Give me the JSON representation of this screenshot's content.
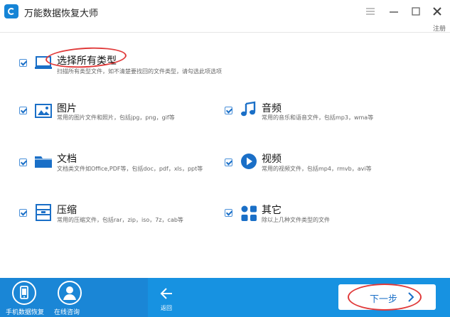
{
  "window": {
    "title": "万能数据恢复大师",
    "register_label": "注册"
  },
  "options": {
    "all": {
      "title": "选择所有类型",
      "desc": "扫描所有类型文件，如不清楚要找回的文件类型，请勾选此项选项",
      "checked": true,
      "icon": "monitor-icon"
    },
    "images": {
      "title": "图片",
      "desc": "常用的图片文件和照片，包括jpg，png，gif等",
      "checked": true,
      "icon": "image-icon"
    },
    "audio": {
      "title": "音频",
      "desc": "常用的音乐和语音文件，包括mp3，wma等",
      "checked": true,
      "icon": "music-note-icon"
    },
    "documents": {
      "title": "文档",
      "desc": "文档类文件如Office,PDF等，包括doc，pdf，xls，ppt等",
      "checked": true,
      "icon": "folder-icon"
    },
    "video": {
      "title": "视频",
      "desc": "常用的视频文件，包括mp4，rmvb，avi等",
      "checked": true,
      "icon": "play-icon"
    },
    "archives": {
      "title": "压缩",
      "desc": "常用的压缩文件，包括rar，zip，iso，7z，cab等",
      "checked": true,
      "icon": "archive-icon"
    },
    "other": {
      "title": "其它",
      "desc": "除以上几种文件类型的文件",
      "checked": true,
      "icon": "grid-icon"
    }
  },
  "footer": {
    "phone_recovery_label": "手机数据恢复",
    "online_consult_label": "在线咨询",
    "back_label": "返回",
    "next_label": "下一步"
  },
  "colors": {
    "accent": "#1792e1",
    "footer_left": "#1a86d6",
    "annotation": "#e03a3a"
  }
}
